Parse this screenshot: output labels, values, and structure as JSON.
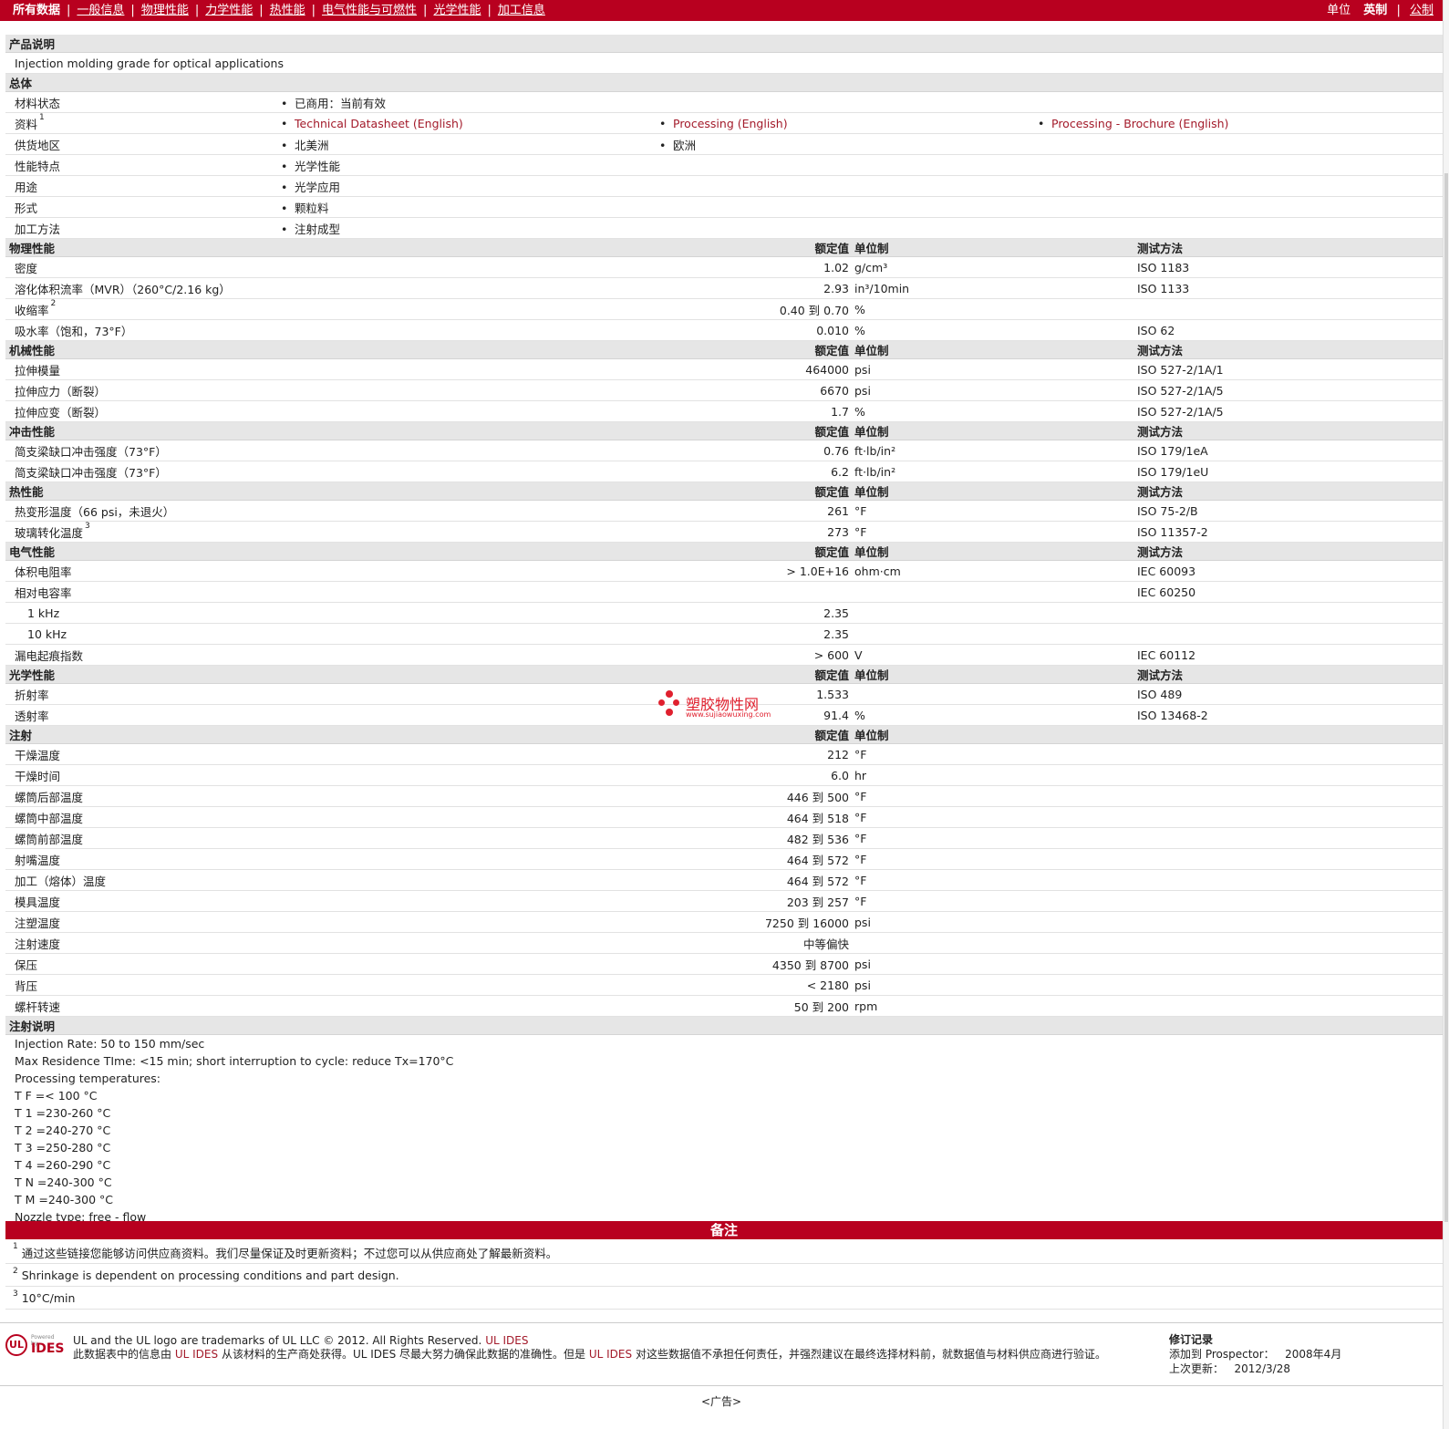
{
  "topnav": {
    "items": [
      "所有数据",
      "一般信息",
      "物理性能",
      "力学性能",
      "热性能",
      "电气性能与可燃性",
      "光学性能",
      "加工信息"
    ],
    "units_label": "单位",
    "unit_imperial": "英制",
    "unit_metric": "公制"
  },
  "product": {
    "title": "产品说明",
    "description": "Injection molding grade for optical applications"
  },
  "general": {
    "title": "总体",
    "rows": [
      {
        "label": "材料状态",
        "sup": "",
        "values": [
          "已商用：当前有效"
        ]
      },
      {
        "label": "资料",
        "sup": "1",
        "values": [
          "Technical Datasheet (English)",
          "Processing (English)",
          "Processing - Brochure (English)"
        ]
      },
      {
        "label": "供货地区",
        "sup": "",
        "values": [
          "北美洲",
          "欧洲"
        ]
      },
      {
        "label": "性能特点",
        "sup": "",
        "values": [
          "光学性能"
        ]
      },
      {
        "label": "用途",
        "sup": "",
        "values": [
          "光学应用"
        ]
      },
      {
        "label": "形式",
        "sup": "",
        "values": [
          "颗粒料"
        ]
      },
      {
        "label": "加工方法",
        "sup": "",
        "values": [
          "注射成型"
        ]
      }
    ]
  },
  "col_headers": {
    "nominal": "额定值",
    "unit": "单位制",
    "test": "测试方法"
  },
  "physical": {
    "title": "物理性能",
    "rows": [
      {
        "label": "密度",
        "sup": "",
        "value": "1.02",
        "unit": "g/cm³",
        "test": "ISO 1183"
      },
      {
        "label": "溶化体积流率（MVR）（260°C/2.16 kg）",
        "sup": "",
        "value": "2.93",
        "unit": "in³/10min",
        "test": "ISO 1133"
      },
      {
        "label": "收缩率",
        "sup": "2",
        "value": "0.40 到  0.70",
        "unit": "%",
        "test": ""
      },
      {
        "label": "吸水率（饱和，73°F）",
        "sup": "",
        "value": "0.010",
        "unit": "%",
        "test": "ISO 62"
      }
    ]
  },
  "mechanical": {
    "title": "机械性能",
    "rows": [
      {
        "label": "拉伸模量",
        "sup": "",
        "value": "464000",
        "unit": "psi",
        "test": "ISO 527-2/1A/1"
      },
      {
        "label": "拉伸应力（断裂）",
        "sup": "",
        "value": "6670",
        "unit": "psi",
        "test": "ISO 527-2/1A/5"
      },
      {
        "label": "拉伸应变（断裂）",
        "sup": "",
        "value": "1.7",
        "unit": "%",
        "test": "ISO 527-2/1A/5"
      }
    ]
  },
  "impact": {
    "title": "冲击性能",
    "rows": [
      {
        "label": "简支梁缺口冲击强度（73°F）",
        "sup": "",
        "value": "0.76",
        "unit": "ft·lb/in²",
        "test": "ISO 179/1eA"
      },
      {
        "label": "简支梁缺口冲击强度（73°F）",
        "sup": "",
        "value": "6.2",
        "unit": "ft·lb/in²",
        "test": "ISO 179/1eU"
      }
    ]
  },
  "thermal": {
    "title": "热性能",
    "rows": [
      {
        "label": "热变形温度（66 psi，未退火）",
        "sup": "",
        "value": "261",
        "unit": "°F",
        "test": "ISO 75-2/B"
      },
      {
        "label": "玻璃转化温度",
        "sup": "3",
        "value": "273",
        "unit": "°F",
        "test": "ISO 11357-2"
      }
    ]
  },
  "electrical": {
    "title": "电气性能",
    "rows": [
      {
        "label": "体积电阻率",
        "sup": "",
        "value": "> 1.0E+16",
        "unit": "ohm·cm",
        "test": "IEC 60093",
        "sub": false
      },
      {
        "label": "相对电容率",
        "sup": "",
        "value": "",
        "unit": "",
        "test": "IEC 60250",
        "sub": false
      },
      {
        "label": "1 kHz",
        "sup": "",
        "value": "2.35",
        "unit": "",
        "test": "",
        "sub": true
      },
      {
        "label": "10 kHz",
        "sup": "",
        "value": "2.35",
        "unit": "",
        "test": "",
        "sub": true
      },
      {
        "label": "漏电起痕指数",
        "sup": "",
        "value": "> 600",
        "unit": "V",
        "test": "IEC 60112",
        "sub": false
      }
    ]
  },
  "optical": {
    "title": "光学性能",
    "rows": [
      {
        "label": "折射率",
        "sup": "",
        "value": "1.533",
        "unit": "",
        "test": "ISO 489"
      },
      {
        "label": "透射率",
        "sup": "",
        "value": "91.4",
        "unit": "%",
        "test": "ISO 13468-2"
      }
    ]
  },
  "injection": {
    "title": "注射",
    "rows": [
      {
        "label": "干燥温度",
        "value": "212",
        "unit": "°F"
      },
      {
        "label": "干燥时间",
        "value": "6.0",
        "unit": "hr"
      },
      {
        "label": "螺筒后部温度",
        "value": "446 到  500",
        "unit": "°F"
      },
      {
        "label": "螺筒中部温度",
        "value": "464 到  518",
        "unit": "°F"
      },
      {
        "label": "螺筒前部温度",
        "value": "482 到  536",
        "unit": "°F"
      },
      {
        "label": "射嘴温度",
        "value": "464 到  572",
        "unit": "°F"
      },
      {
        "label": "加工（熔体）温度",
        "value": "464 到  572",
        "unit": "°F"
      },
      {
        "label": "模具温度",
        "value": "203 到  257",
        "unit": "°F"
      },
      {
        "label": "注塑温度",
        "value": "7250 到  16000",
        "unit": "psi"
      },
      {
        "label": "注射速度",
        "value": "中等偏快",
        "unit": ""
      },
      {
        "label": "保压",
        "value": "4350 到  8700",
        "unit": "psi"
      },
      {
        "label": "背压",
        "value": "< 2180",
        "unit": "psi"
      },
      {
        "label": "螺杆转速",
        "value": "50 到  200",
        "unit": "rpm"
      }
    ]
  },
  "injection_notes": {
    "title": "注射说明",
    "lines": [
      "Injection Rate: 50 to 150 mm/sec",
      "Max Residence TIme: <15 min; short interruption to cycle: reduce Tx=170°C",
      "Processing temperatures:",
      "T F =< 100 °C",
      "T 1 =230-260 °C",
      "T 2 =240-270 °C",
      "T 3 =250-280 °C",
      "T 4 =260-290 °C",
      "T N =240-300 °C",
      "T M =240-300 °C",
      "Nozzle type: free - flow"
    ]
  },
  "annotations": {
    "title": "备注",
    "notes": [
      {
        "num": "1",
        "text": "通过这些链接您能够访问供应商资料。我们尽量保证及时更新资料；不过您可以从供应商处了解最新资料。"
      },
      {
        "num": "2",
        "text": "Shrinkage is dependent on processing conditions and part design."
      },
      {
        "num": "3",
        "text": "10°C/min"
      }
    ]
  },
  "footer": {
    "logo_powered": "Powered by",
    "logo_ul": "UL",
    "logo_ides": "IDES",
    "trademark": "UL and the UL logo are trademarks of UL LLC © 2012. All Rights Reserved.",
    "trademark_link": "UL IDES",
    "disclaimer_1": "此数据表中的信息由",
    "disclaimer_ides_1": "UL IDES",
    "disclaimer_2": "从该材料的生产商处获得。UL IDES 尽最大努力确保此数据的准确性。但是",
    "disclaimer_ides_2": "UL IDES",
    "disclaimer_3": "对这些数据值不承担任何责任，并强烈建议在最终选择材料前，就数据值与材料供应商进行验证。",
    "revision_title": "修订记录",
    "added_label": "添加到  Prospector：",
    "added_value": "2008年4月",
    "updated_label": "上次更新：",
    "updated_value": "2012/3/28"
  },
  "ad": "<广告>",
  "watermark": {
    "text": "塑胶物性网",
    "url": "www.sujiaowuxing.com"
  }
}
